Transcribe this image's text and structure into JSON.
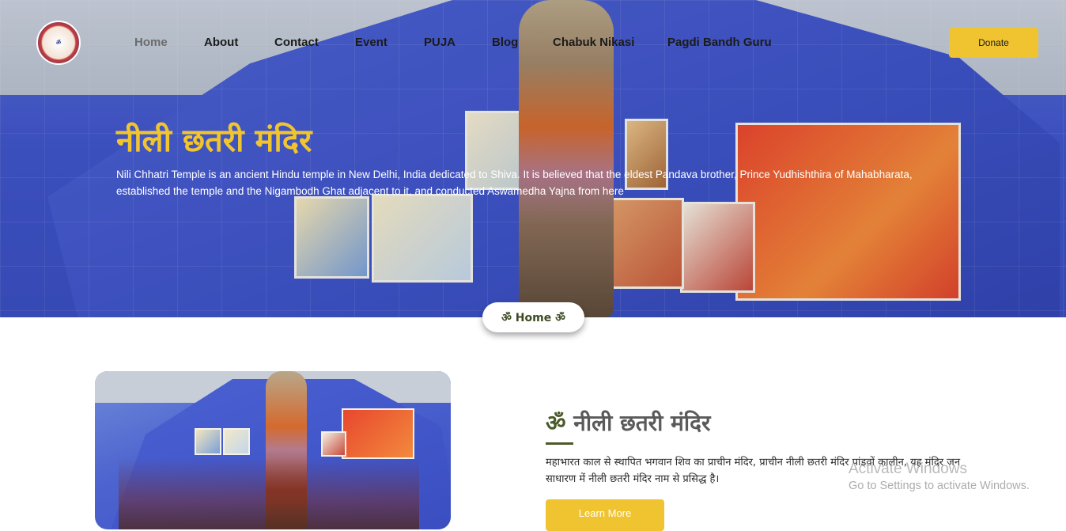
{
  "nav": {
    "items": [
      {
        "label": "Home",
        "active": true
      },
      {
        "label": "About"
      },
      {
        "label": "Contact"
      },
      {
        "label": "Event"
      },
      {
        "label": "PUJA"
      },
      {
        "label": "Blog"
      },
      {
        "label": "Chabuk Nikasi"
      },
      {
        "label": "Pagdi Bandh Guru"
      }
    ],
    "donate_label": "Donate"
  },
  "hero": {
    "title": "नीली छतरी मंदिर",
    "description": "Nili Chhatri Temple is an ancient Hindu temple in New Delhi, India dedicated to Shiva. It is believed that the eldest Pandava brother, Prince Yudhishthira of Mahabharata, established the temple and the Nigambodh Ghat adjacent to it, and conducted Aswamedha Yajna from here",
    "breadcrumb": "ॐ Home ॐ"
  },
  "about": {
    "om": "ॐ",
    "title": "नीली छतरी मंदिर",
    "description": "महाभारत काल से स्थापित भगवान शिव का प्राचीन मंदिर, प्राचीन नीली छतरी मंदिर पांडवों कालीन, यह मंदिर जन साधारण में नीली छतरी मंदिर नाम से प्रसिद्ध है।",
    "button_label": "Learn More"
  },
  "watermark": {
    "line1": "Activate Windows",
    "line2": "Go to Settings to activate Windows."
  },
  "colors": {
    "accent": "#f0c430",
    "title_gold": "#f2c52d",
    "olive": "#4a5a2a"
  }
}
